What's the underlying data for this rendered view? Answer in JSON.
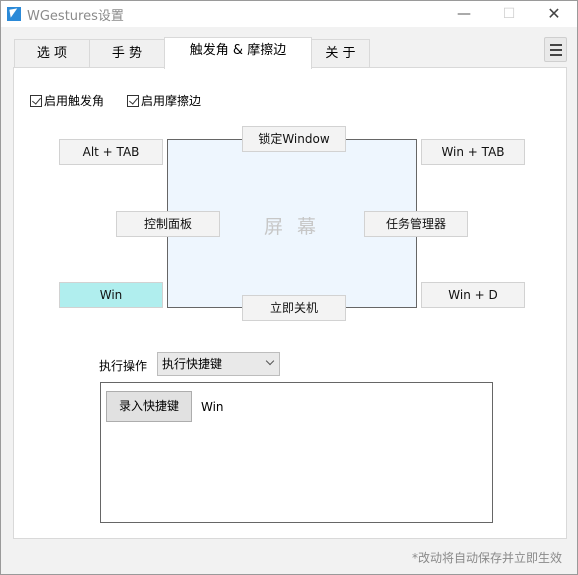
{
  "window": {
    "title": "WGestures设置",
    "minimize_glyph": "—",
    "maximize_glyph": "☐",
    "close_glyph": "✕"
  },
  "tabs": [
    {
      "label": "选 项",
      "active": false
    },
    {
      "label": "手 势",
      "active": false
    },
    {
      "label": "触发角 & 摩擦边",
      "active": true
    },
    {
      "label": "关 于",
      "active": false
    }
  ],
  "panel": {
    "checkboxes": [
      {
        "label": "启用触发角",
        "checked": true
      },
      {
        "label": "启用摩擦边",
        "checked": true
      }
    ],
    "screen_label": "屏 幕",
    "corners": {
      "top_left": "Alt + TAB",
      "top_right": "Win + TAB",
      "bottom_left": "Win",
      "bottom_right": "Win + D"
    },
    "edges": {
      "top": "锁定Window",
      "left": "控制面板",
      "right": "任务管理器",
      "bottom": "立即关机"
    },
    "selected": "bottom_left",
    "selected_color": "#b0eeee",
    "operation": {
      "label": "执行操作",
      "selected_value": "执行快捷键"
    },
    "shortcut": {
      "record_button": "录入快捷键",
      "value": "Win"
    }
  },
  "footer_note": "*改动将自动保存并立即生效"
}
